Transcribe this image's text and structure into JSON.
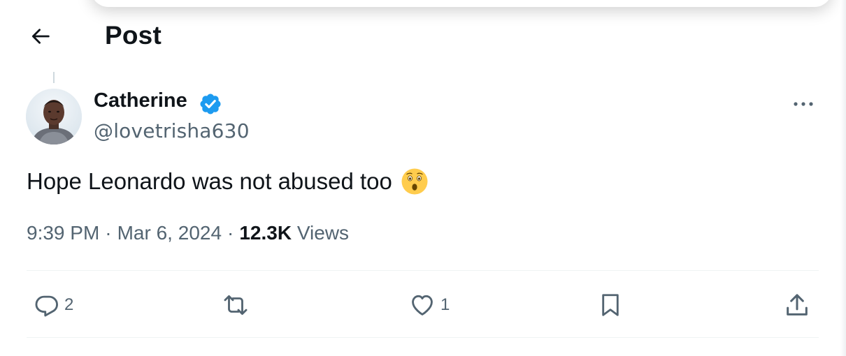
{
  "header": {
    "title": "Post",
    "back_icon": "arrow-left-icon"
  },
  "author": {
    "display_name": "Catherine",
    "handle": "@lovetrisha630",
    "verified": true,
    "verified_color": "#1d9bf0"
  },
  "post": {
    "text": "Hope Leonardo was not abused too",
    "emoji_icon": "astonished-face-emoji"
  },
  "meta": {
    "time": "9:39 PM",
    "date": "Mar 6, 2024",
    "separator": "·",
    "views_count": "12.3K",
    "views_label": "Views"
  },
  "actions": {
    "reply_count": "2",
    "repost_count": "",
    "like_count": "1"
  },
  "colors": {
    "text_primary": "#0f1419",
    "text_secondary": "#536471",
    "accent": "#1d9bf0",
    "divider": "#eff3f4"
  }
}
